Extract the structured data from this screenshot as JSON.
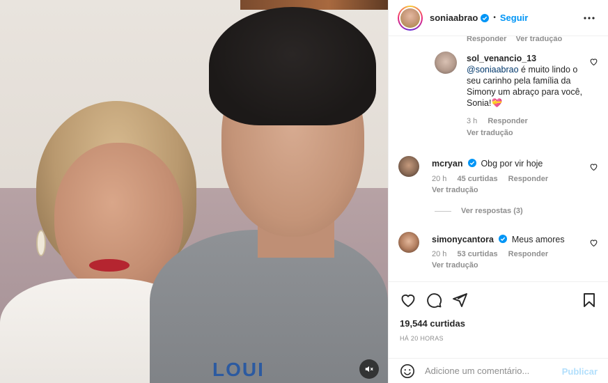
{
  "post": {
    "username": "soniaabrao",
    "follow_label": "Seguir",
    "dot": "•",
    "mute_icon": "speaker-mute-icon"
  },
  "cut_actions": {
    "reply": "Responder",
    "translate": "Ver tradução"
  },
  "comments": [
    {
      "username": "sol_venancio_13",
      "mention": "@soniaabrao",
      "text": " é muito lindo o seu carinho pela família da Simony um abraço para você, Sonia!💝",
      "time": "3 h",
      "reply": "Responder",
      "translate": "Ver tradução"
    },
    {
      "username": "mcryan",
      "verified": true,
      "text": "Obg por vir hoje",
      "time": "20 h",
      "likes": "45 curtidas",
      "reply": "Responder",
      "translate": "Ver tradução",
      "view_replies": "Ver respostas (3)"
    },
    {
      "username": "simonycantora",
      "verified": true,
      "text": "Meus amores",
      "time": "20 h",
      "likes": "53 curtidas",
      "reply": "Responder",
      "translate": "Ver tradução"
    }
  ],
  "stats": {
    "likes": "19,544 curtidas",
    "posted": "HÁ 20 HORAS"
  },
  "add_comment": {
    "placeholder": "Adicione um comentário...",
    "publish": "Publicar"
  },
  "media_text": {
    "shirt_print": "LOUI"
  },
  "colors": {
    "link": "#0095f6",
    "verified": "#0095f6",
    "mention": "#00376b",
    "muted": "#8e8e8e",
    "publish_disabled": "#b2dffc"
  }
}
